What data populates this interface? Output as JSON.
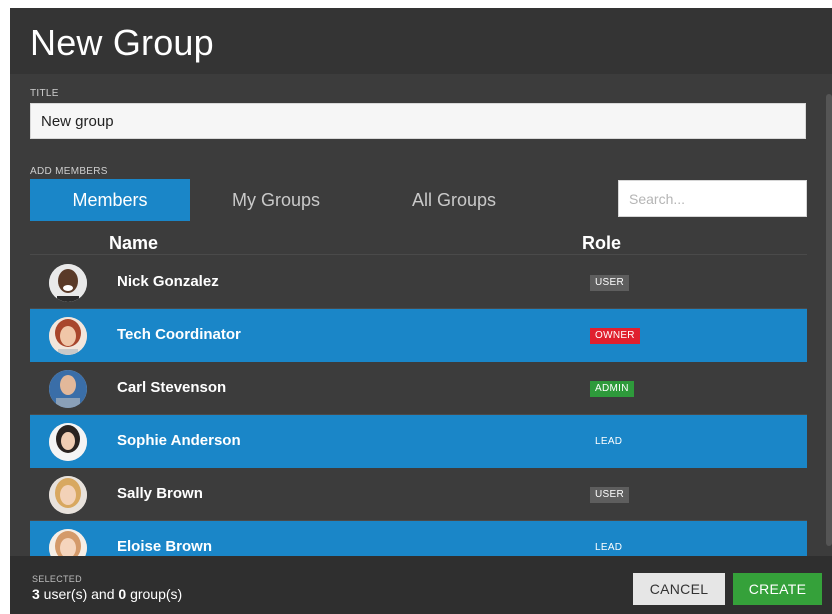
{
  "dialog": {
    "title": "New Group",
    "close_label": "x"
  },
  "title_section": {
    "label": "TITLE",
    "value": "New group"
  },
  "members_section": {
    "label": "ADD MEMBERS",
    "tabs": [
      {
        "label": "Members",
        "active": true
      },
      {
        "label": "My Groups",
        "active": false
      },
      {
        "label": "All Groups",
        "active": false
      }
    ],
    "search_placeholder": "Search...",
    "columns": {
      "name": "Name",
      "role": "Role"
    }
  },
  "members": [
    {
      "name": "Nick Gonzalez",
      "role": "USER",
      "role_type": "user",
      "selected": false
    },
    {
      "name": "Tech Coordinator",
      "role": "OWNER",
      "role_type": "owner",
      "selected": true
    },
    {
      "name": "Carl Stevenson",
      "role": "ADMIN",
      "role_type": "admin",
      "selected": false
    },
    {
      "name": "Sophie Anderson",
      "role": "LEAD",
      "role_type": "lead",
      "selected": true
    },
    {
      "name": "Sally Brown",
      "role": "USER",
      "role_type": "user",
      "selected": false
    },
    {
      "name": "Eloise Brown",
      "role": "LEAD",
      "role_type": "lead",
      "selected": true
    }
  ],
  "footer": {
    "selected_label": "SELECTED",
    "users_count": "3",
    "users_text": " user(s) and ",
    "groups_count": "0",
    "groups_text": " group(s)",
    "cancel_label": "CANCEL",
    "create_label": "CREATE"
  },
  "colors": {
    "accent": "#1a86c8",
    "owner": "#e0202e",
    "admin": "#2e9a3b",
    "create": "#35a13a"
  }
}
